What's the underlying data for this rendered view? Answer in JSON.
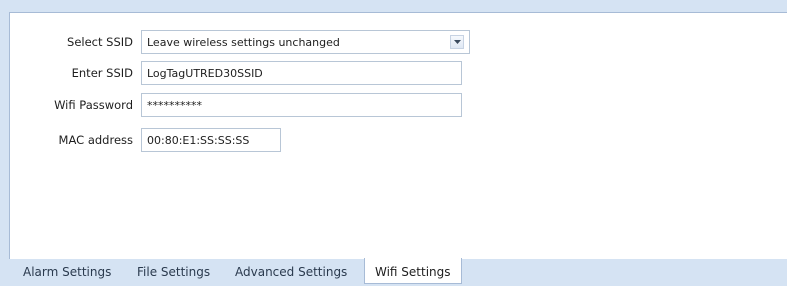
{
  "form": {
    "select_ssid_label": "Select SSID",
    "select_ssid_value": "Leave wireless settings unchanged",
    "enter_ssid_label": "Enter SSID",
    "enter_ssid_value": "LogTagUTRED30SSID",
    "wifi_password_label": "Wifi Password",
    "wifi_password_value": "**********",
    "mac_address_label": "MAC address",
    "mac_address_value": "00:80:E1:SS:SS:SS"
  },
  "tabs": [
    {
      "label": "Alarm Settings",
      "active": false
    },
    {
      "label": "File Settings",
      "active": false
    },
    {
      "label": "Advanced Settings",
      "active": false
    },
    {
      "label": "Wifi Settings",
      "active": true
    }
  ],
  "icons": {
    "dropdown": "chevron-down-icon"
  }
}
